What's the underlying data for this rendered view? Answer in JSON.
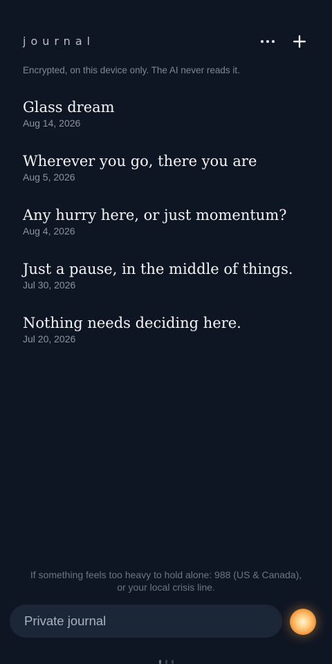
{
  "header": {
    "title": "journal",
    "more_icon": "more-horizontal-icon",
    "add_icon": "plus-icon"
  },
  "subtitle": "Encrypted, on this device only. The AI never reads it.",
  "entries": [
    {
      "title": "Glass dream",
      "date": "Aug 14, 2026"
    },
    {
      "title": "Wherever you go, there you are",
      "date": "Aug 5, 2026"
    },
    {
      "title": "Any hurry here, or just momentum?",
      "date": "Aug 4, 2026"
    },
    {
      "title": "Just a pause, in the middle of things.",
      "date": "Jul 30, 2026"
    },
    {
      "title": "Nothing needs deciding here.",
      "date": "Jul 20, 2026"
    }
  ],
  "crisis_note": {
    "line1": "If something feels too heavy to hold alone: 988 (US & Canada),",
    "line2": "or your local crisis line."
  },
  "composer": {
    "placeholder": "Private journal",
    "value": ""
  },
  "colors": {
    "background": "#0f1623",
    "input_bg": "#1b2636",
    "orb": "#f6a24a"
  }
}
